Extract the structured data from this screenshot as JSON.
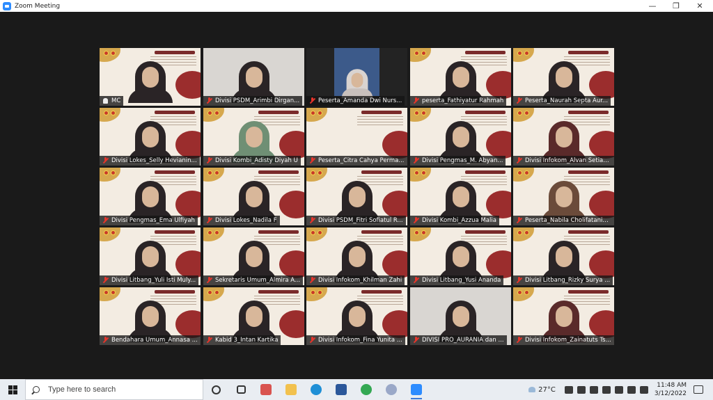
{
  "window": {
    "title": "Zoom Meeting",
    "minimize_icon": "—",
    "maximize_icon": "❐",
    "close_icon": "✕"
  },
  "participants": [
    {
      "name": "MC",
      "muted": false,
      "video": "slide",
      "active": true,
      "person": "dark"
    },
    {
      "name": "Divisi PSDM_Arimbi Dirgan...",
      "muted": true,
      "video": "camera",
      "person": "dark"
    },
    {
      "name": "Peserta_Amanda Dwi Nurs...",
      "muted": true,
      "video": "camera-small",
      "person": "light"
    },
    {
      "name": "peserta_Fathiyatur Rahmah",
      "muted": true,
      "video": "slide",
      "person": "dark"
    },
    {
      "name": "Peserta_Naurah Septa Aur...",
      "muted": true,
      "video": "slide",
      "person": "dark"
    },
    {
      "name": "Divisi Lokes_Selly Hevianin...",
      "muted": true,
      "video": "slide",
      "person": "dark"
    },
    {
      "name": "Divisi Kombi_Adisty Diyah U",
      "muted": true,
      "video": "slide",
      "person": "green"
    },
    {
      "name": "Peserta_Citra Cahya Perma...",
      "muted": true,
      "video": "slide",
      "person": "none"
    },
    {
      "name": "Divisi Pengmas_M. Abyan...",
      "muted": true,
      "video": "slide",
      "person": "dark"
    },
    {
      "name": "Divisi Infokom_Alvan Setiaw...",
      "muted": true,
      "video": "slide",
      "person": "maroon"
    },
    {
      "name": "Divisi Pengmas_Ema Ulfiyah",
      "muted": true,
      "video": "slide",
      "person": "dark"
    },
    {
      "name": "Divisi Lokes_Nadila F",
      "muted": true,
      "video": "slide",
      "person": "dark"
    },
    {
      "name": "Divisi PSDM_Fitri Sofiatul R...",
      "muted": true,
      "video": "slide",
      "person": "dark"
    },
    {
      "name": "Divisi Kombi_Azzua Malia",
      "muted": true,
      "video": "slide",
      "person": "dark"
    },
    {
      "name": "Peserta_Nabila Cholifatania...",
      "muted": true,
      "video": "slide",
      "person": "brown"
    },
    {
      "name": "Divisi Litbang_Yuli Isti Muly...",
      "muted": true,
      "video": "slide",
      "person": "dark"
    },
    {
      "name": "Sekretaris Umum_Almira A...",
      "muted": true,
      "video": "slide",
      "person": "dark"
    },
    {
      "name": "Divisi Infokom_Khilman Zahi",
      "muted": true,
      "video": "slide",
      "person": "dark"
    },
    {
      "name": "Divisi Litbang_Yusi Ananda",
      "muted": true,
      "video": "slide",
      "person": "dark"
    },
    {
      "name": "Divisi Litbang_Rizky Surya ...",
      "muted": true,
      "video": "slide",
      "person": "dark"
    },
    {
      "name": "Bendahara Umum_Annasa ...",
      "muted": true,
      "video": "slide",
      "person": "dark"
    },
    {
      "name": "Kabid 3_Intan Kartika",
      "muted": true,
      "video": "slide",
      "person": "dark"
    },
    {
      "name": "Divisi Infokom_Fina Yunita ...",
      "muted": true,
      "video": "slide",
      "person": "dark"
    },
    {
      "name": "DIVISI PRO_AURANIA dan ...",
      "muted": true,
      "video": "camera",
      "person": "dark"
    },
    {
      "name": "Divisi Infokom_Zainatuts Ts...",
      "muted": true,
      "video": "slide",
      "person": "maroon"
    }
  ],
  "taskbar": {
    "search_placeholder": "Type here to search",
    "apps": [
      {
        "name": "cortana-icon",
        "color": "#333333",
        "active": false
      },
      {
        "name": "task-view-icon",
        "color": "#333333",
        "active": false
      },
      {
        "name": "gift-icon",
        "color": "#d9534f",
        "active": false
      },
      {
        "name": "file-explorer-icon",
        "color": "#f2c14e",
        "active": false
      },
      {
        "name": "edge-icon",
        "color": "#1f8fd6",
        "active": false
      },
      {
        "name": "word-icon",
        "color": "#2b579a",
        "active": false
      },
      {
        "name": "chrome-icon",
        "color": "#34a853",
        "active": false
      },
      {
        "name": "r-app-icon",
        "color": "#9aa8c8",
        "active": false
      },
      {
        "name": "zoom-icon",
        "color": "#2d8cff",
        "active": true
      }
    ],
    "weather": "27°C",
    "time": "11:48 AM",
    "date": "3/12/2022"
  }
}
